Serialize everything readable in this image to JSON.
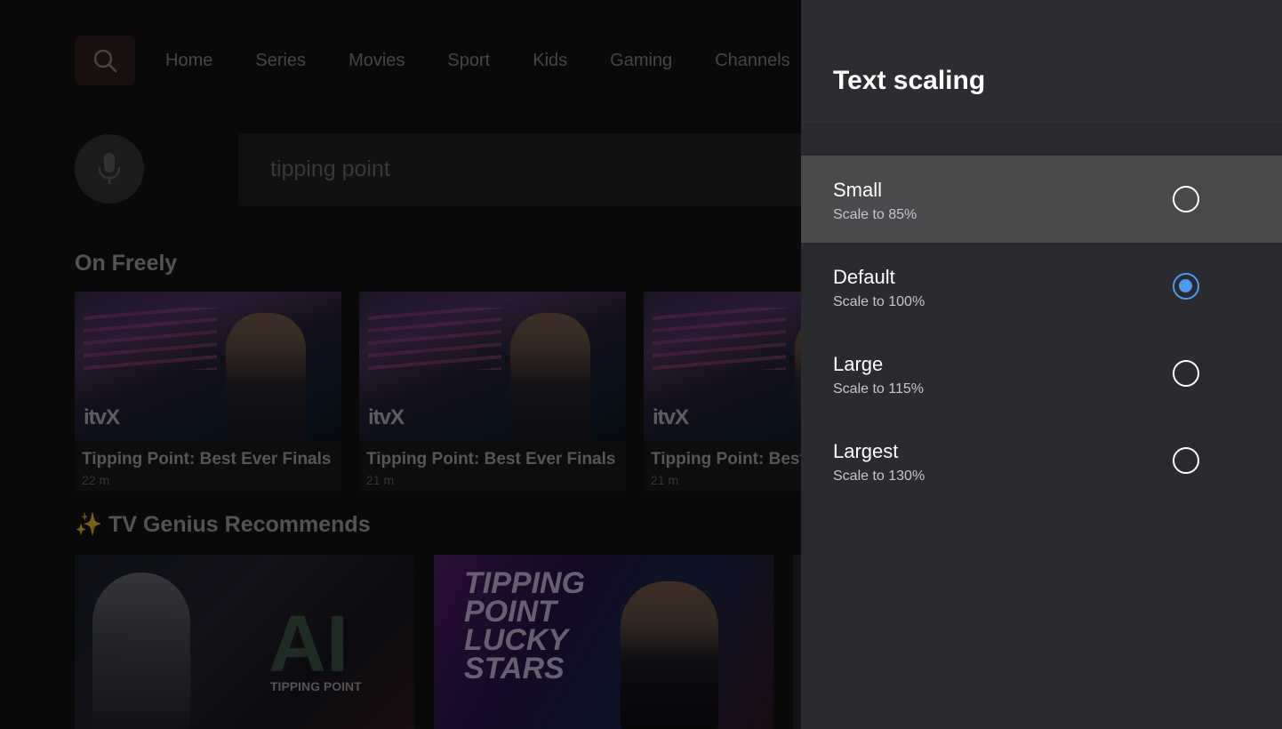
{
  "background": {
    "nav": {
      "items": [
        "Home",
        "Series",
        "Movies",
        "Sport",
        "Kids",
        "Gaming",
        "Channels"
      ]
    },
    "search": {
      "query": "tipping point"
    },
    "sections": [
      {
        "title": "On Freely",
        "cards": [
          {
            "logo": "itvX",
            "title": "Tipping Point: Best Ever Finals",
            "meta": "22 m"
          },
          {
            "logo": "itvX",
            "title": "Tipping Point: Best Ever Finals",
            "meta": "21 m"
          },
          {
            "logo": "itvX",
            "title": "Tipping Point: Best",
            "meta": "21 m"
          }
        ]
      },
      {
        "title": "✨ TV Genius Recommends",
        "cards": [
          {
            "art_text": "AI",
            "caption": "TIPPING POINT"
          },
          {
            "art_text": "TIPPING POINT LUCKY STARS"
          }
        ]
      }
    ]
  },
  "panel": {
    "title": "Text scaling",
    "options": [
      {
        "label": "Small",
        "sub": "Scale to 85%",
        "selected": false,
        "focused": true
      },
      {
        "label": "Default",
        "sub": "Scale to 100%",
        "selected": true,
        "focused": false
      },
      {
        "label": "Large",
        "sub": "Scale to 115%",
        "selected": false,
        "focused": false
      },
      {
        "label": "Largest",
        "sub": "Scale to 130%",
        "selected": false,
        "focused": false
      }
    ]
  },
  "colors": {
    "accent": "#4a9cf0",
    "panel_bg": "#2a2b2e",
    "focus_bg": "#4a4a4d"
  }
}
